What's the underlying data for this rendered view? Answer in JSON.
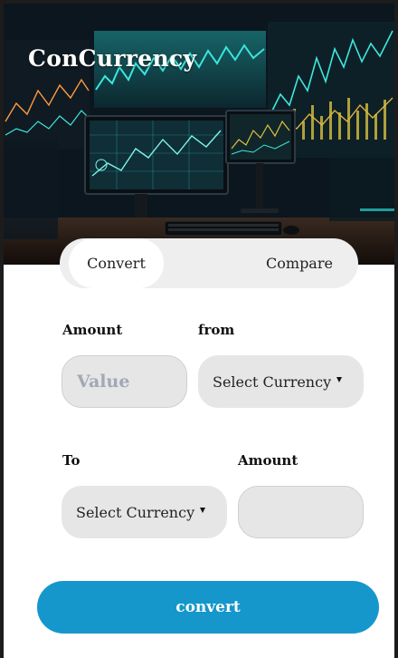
{
  "app": {
    "title": "ConCurrency"
  },
  "tabs": [
    {
      "label": "Convert",
      "active": true
    },
    {
      "label": "Compare",
      "active": false
    }
  ],
  "form": {
    "amount_from": {
      "label": "Amount",
      "placeholder": "Value",
      "value": ""
    },
    "from": {
      "label": "from",
      "selected": "Select Currency"
    },
    "to": {
      "label": "To",
      "selected": "Select Currency"
    },
    "amount_to": {
      "label": "Amount",
      "value": ""
    }
  },
  "actions": {
    "convert_label": "convert"
  },
  "colors": {
    "accent": "#1597cc",
    "field_bg": "#e6e6e6",
    "tab_bg": "#eeeeee"
  }
}
